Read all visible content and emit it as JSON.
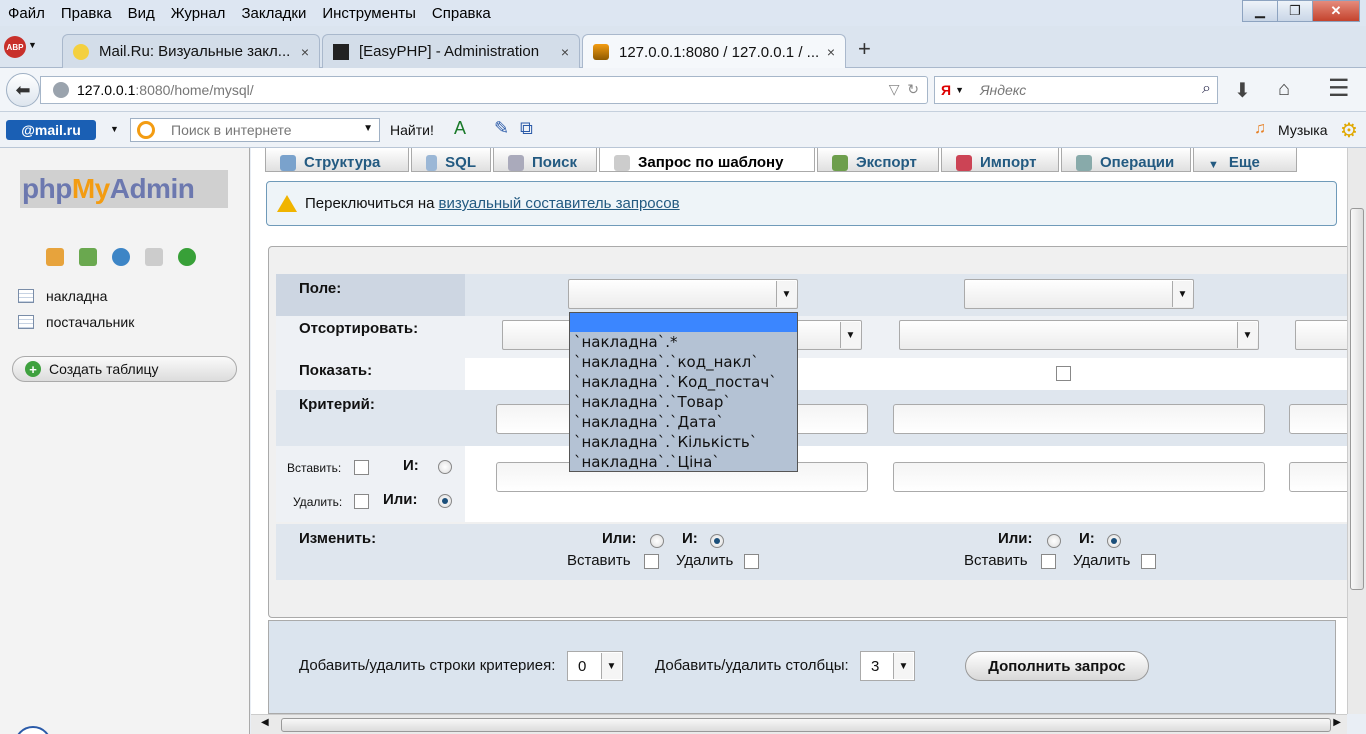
{
  "menu": [
    "Файл",
    "Правка",
    "Вид",
    "Журнал",
    "Закладки",
    "Инструменты",
    "Справка"
  ],
  "tabs": [
    {
      "title": "Mail.Ru: Визуальные закл...",
      "close": "×"
    },
    {
      "title": "[EasyPHP] - Administration",
      "close": "×"
    },
    {
      "title": "127.0.0.1:8080 / 127.0.0.1 / ...",
      "close": "×"
    }
  ],
  "new_tab": "+",
  "address": {
    "host": "127.0.0.1",
    "rest": ":8080/home/mysql/"
  },
  "search": {
    "engine": "Я",
    "placeholder": "Яндекс"
  },
  "mailbar": {
    "logo": "@mail.ru",
    "placeholder": "Поиск в интернете",
    "find": "Найти!",
    "music": "Музыка"
  },
  "sidebar": {
    "logo_php": "php",
    "logo_my": "My",
    "logo_admin": "Admin",
    "tables": [
      "накладна",
      "постачальник"
    ],
    "create_table": "Создать таблицу"
  },
  "content_tabs": [
    "Структура",
    "SQL",
    "Поиск",
    "Запрос по шаблону",
    "Экспорт",
    "Импорт",
    "Операции",
    "Еще"
  ],
  "notice": {
    "text": "Переключиться на",
    "link": "визуальный составитель запросов"
  },
  "query": {
    "labels": {
      "field": "Поле:",
      "sort": "Отсортировать:",
      "show": "Показать:",
      "criteria": "Критерий:",
      "change": "Изменить:"
    },
    "insert_label": "Вставить:",
    "delete_label": "Удалить:",
    "and_label": "И:",
    "or_label": "Или:",
    "or_short": "Или:",
    "and_short": "И:",
    "insert_word": "Вставить",
    "delete_word": "Удалить"
  },
  "dropdown_options": [
    "`накладна`.*",
    "`накладна`.`код_накл`",
    "`накладна`.`Код_постач`",
    "`накладна`.`Товар`",
    "`накладна`.`Дата`",
    "`накладна`.`Кількість`",
    "`накладна`.`Ціна`"
  ],
  "footer": {
    "rows_label": "Добавить/удалить строки критериея:",
    "rows_value": "0",
    "cols_label": "Добавить/удалить столбцы:",
    "cols_value": "3",
    "submit": "Дополнить запрос"
  }
}
